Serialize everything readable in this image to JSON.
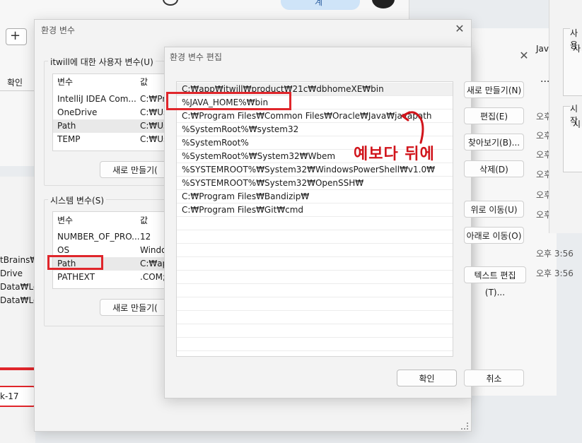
{
  "bg_top": {
    "header_button": "계",
    "add_symbol": "+",
    "confirm_left": "확인"
  },
  "bg_left_list": [
    "tBrains₩I",
    "Drive",
    "Data₩Lo",
    "Data₩Lo"
  ],
  "bg_left_input": "k-17",
  "bg_right": {
    "tab_fragment": "Jav",
    "dots": "···",
    "label_top": "사용",
    "label_top2": "사",
    "label_mid": "시작",
    "label_mid2": "시",
    "times": [
      "오후",
      "오후",
      "오후",
      "오후",
      "오후",
      "오후",
      "오후 3:56",
      "오후 3:56"
    ]
  },
  "env_dialog": {
    "title": "환경 변수",
    "user_group_label": "itwill에 대한 사용자 변수(U)",
    "col_var": "변수",
    "col_val": "값",
    "user_vars": [
      {
        "name": "IntelliJ IDEA Com...",
        "value": "C:₩Pr"
      },
      {
        "name": "OneDrive",
        "value": "C:₩Us"
      },
      {
        "name": "Path",
        "value": "C:₩Us"
      },
      {
        "name": "TEMP",
        "value": "C:₩Us"
      }
    ],
    "user_new_button": "새로 만들기(",
    "system_group_label": "시스템 변수(S)",
    "system_vars": [
      {
        "name": "NUMBER_OF_PRO...",
        "value": "12"
      },
      {
        "name": "OS",
        "value": "Windo"
      },
      {
        "name": "Path",
        "value": "C:₩ap"
      },
      {
        "name": "PATHEXT",
        "value": ".COM;"
      }
    ],
    "system_new_button": "새로 만들기("
  },
  "edit_dialog": {
    "title": "환경 변수 편집",
    "paths": [
      "C:₩app₩itwill₩product₩21c₩dbhomeXE₩bin",
      "%JAVA_HOME%₩bin",
      "C:₩Program Files₩Common Files₩Oracle₩Java₩javapath",
      "%SystemRoot%₩system32",
      "%SystemRoot%",
      "%SystemRoot%₩System32₩Wbem",
      "%SYSTEMROOT%₩System32₩WindowsPowerShell₩v1.0₩",
      "%SYSTEMROOT%₩System32₩OpenSSH₩",
      "C:₩Program Files₩Bandizip₩",
      "C:₩Program Files₩Git₩cmd"
    ],
    "buttons": {
      "new": "새로 만들기(N)",
      "edit": "편집(E)",
      "browse": "찾아보기(B)...",
      "delete": "삭제(D)",
      "move_up": "위로 이동(U)",
      "move_down": "아래로 이동(O)",
      "edit_text": "텍스트 편집(T)...",
      "ok": "확인",
      "cancel": "취소"
    },
    "annotation": "예보다 뒤에"
  },
  "colors": {
    "highlight": "#e0262b",
    "annotation": "#d1141b"
  }
}
